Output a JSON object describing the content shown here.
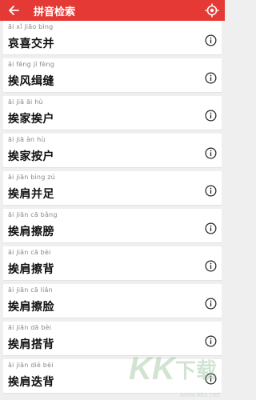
{
  "header": {
    "title": "拼音检索",
    "back_icon": "arrow-left-icon",
    "locate_icon": "target-icon"
  },
  "items": [
    {
      "pinyin": "āi xǐ jiāo bìng",
      "word": "哀喜交并"
    },
    {
      "pinyin": "āi fēng jī fèng",
      "word": "挨风缉缝"
    },
    {
      "pinyin": "āi jiā āi hù",
      "word": "挨家挨户"
    },
    {
      "pinyin": "āi jiā àn hù",
      "word": "挨家按户"
    },
    {
      "pinyin": "āi jiān bìng zú",
      "word": "挨肩并足"
    },
    {
      "pinyin": "āi jiān cā bǎng",
      "word": "挨肩擦膀"
    },
    {
      "pinyin": "āi jiān cā bèi",
      "word": "挨肩擦背"
    },
    {
      "pinyin": "āi jiān cā liǎn",
      "word": "挨肩擦脸"
    },
    {
      "pinyin": "āi jiān dā bèi",
      "word": "挨肩搭背"
    },
    {
      "pinyin": "āi jiān dié bèi",
      "word": "挨肩迭背"
    }
  ],
  "watermark": {
    "logo_text": "KK下载",
    "url": "www.kkx.net"
  },
  "colors": {
    "header_bg": "#e53935",
    "list_bg": "#efefef"
  }
}
